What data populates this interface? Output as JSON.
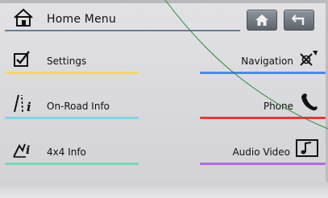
{
  "header": {
    "title": "Home Menu",
    "home_button_icon": "home-icon",
    "back_button_icon": "back-arrow-icon"
  },
  "menu": {
    "settings": {
      "label": "Settings",
      "icon": "checkbox-icon",
      "color": "#f2d66b"
    },
    "navigation": {
      "label": "Navigation",
      "icon": "navigation-icon",
      "color": "#4e88e6"
    },
    "onroad": {
      "label": "On-Road Info",
      "icon": "road-info-icon",
      "color": "#7fd6e4"
    },
    "phone": {
      "label": "Phone",
      "icon": "phone-icon",
      "color": "#e23a3a"
    },
    "fourbyfour": {
      "label": "4x4 Info",
      "icon": "offroad-info-icon",
      "color": "#79d6b2"
    },
    "audio": {
      "label": "Audio Video",
      "icon": "music-note-icon",
      "color": "#b06ae0"
    }
  }
}
